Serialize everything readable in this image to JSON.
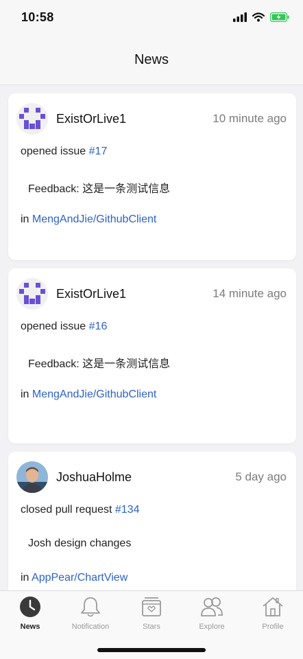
{
  "status": {
    "time": "10:58"
  },
  "header": {
    "title": "News"
  },
  "feed": [
    {
      "user": "ExistOrLive1",
      "time_ago": "10 minute ago",
      "action": "opened issue",
      "ref": "#17",
      "detail": "Feedback: 这是一条测试信息",
      "repo_prefix": "in",
      "repo": "MengAndJie/GithubClient",
      "avatar": "identicon"
    },
    {
      "user": "ExistOrLive1",
      "time_ago": "14 minute ago",
      "action": "opened issue",
      "ref": "#16",
      "detail": "Feedback: 这是一条测试信息",
      "repo_prefix": "in",
      "repo": "MengAndJie/GithubClient",
      "avatar": "identicon"
    },
    {
      "user": "JoshuaHolme",
      "time_ago": "5 day ago",
      "action": "closed pull request",
      "ref": "#134",
      "detail": "Josh design changes",
      "repo_prefix": "in",
      "repo": "AppPear/ChartView",
      "avatar": "photo"
    }
  ],
  "tabs": [
    {
      "label": "News",
      "icon": "news-icon",
      "active": true
    },
    {
      "label": "Notification",
      "icon": "bell-icon",
      "active": false
    },
    {
      "label": "Stars",
      "icon": "stars-box-icon",
      "active": false
    },
    {
      "label": "Explore",
      "icon": "people-icon",
      "active": false
    },
    {
      "label": "Profile",
      "icon": "home-icon",
      "active": false
    }
  ],
  "colors": {
    "link": "#2d62c6",
    "identicon": "#6a4fd6",
    "battery": "#34c759"
  }
}
